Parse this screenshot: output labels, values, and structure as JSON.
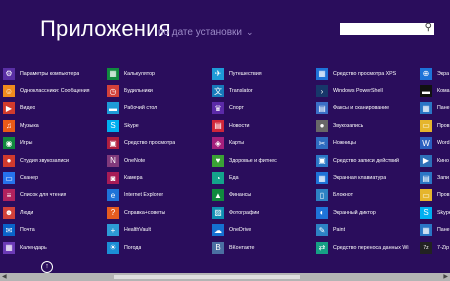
{
  "header": {
    "title": "Приложения",
    "sort_label": "по дате установки"
  },
  "columns": [
    [
      {
        "label": "Параметры компьютера",
        "icon": "gear-icon",
        "glyph": "⚙",
        "color": "#5a2fa5"
      },
      {
        "label": "Одноклассники: Сообщения",
        "icon": "ok-icon",
        "glyph": "☺",
        "color": "#f08b1d"
      },
      {
        "label": "Видео",
        "icon": "video-icon",
        "glyph": "▶",
        "color": "#d23b2c"
      },
      {
        "label": "Музыка",
        "icon": "headphones-icon",
        "glyph": "♫",
        "color": "#e95a17"
      },
      {
        "label": "Игры",
        "icon": "gamepad-icon",
        "glyph": "◉",
        "color": "#10893e"
      },
      {
        "label": "Студия звукозаписи",
        "icon": "microphone-icon",
        "glyph": "●",
        "color": "#d13a2d"
      },
      {
        "label": "Сканер",
        "icon": "scanner-icon",
        "glyph": "▭",
        "color": "#2672ec"
      },
      {
        "label": "Список для чтения",
        "icon": "reading-list-icon",
        "glyph": "≡",
        "color": "#b1225e"
      },
      {
        "label": "Люди",
        "icon": "people-icon",
        "glyph": "☻",
        "color": "#d2413a"
      },
      {
        "label": "Почта",
        "icon": "mail-icon",
        "glyph": "✉",
        "color": "#0a63c9"
      },
      {
        "label": "Календарь",
        "icon": "calendar-icon",
        "glyph": "▦",
        "color": "#6b3ab6"
      }
    ],
    [
      {
        "label": "Калькулятор",
        "icon": "calculator-icon",
        "glyph": "▦",
        "color": "#10893e"
      },
      {
        "label": "Будильники",
        "icon": "alarm-icon",
        "glyph": "◷",
        "color": "#d2413a"
      },
      {
        "label": "Рабочий стол",
        "icon": "desktop-icon",
        "glyph": "▬",
        "color": "#1e9ad7"
      },
      {
        "label": "Skype",
        "icon": "skype-icon",
        "glyph": "S",
        "color": "#00aff0"
      },
      {
        "label": "Средство просмотра",
        "icon": "viewer-icon",
        "glyph": "▣",
        "color": "#b01e3e"
      },
      {
        "label": "OneNote",
        "icon": "onenote-icon",
        "glyph": "N",
        "color": "#80397b"
      },
      {
        "label": "Камера",
        "icon": "camera-icon",
        "glyph": "◙",
        "color": "#a81b56"
      },
      {
        "label": "Internet Explorer",
        "icon": "ie-icon",
        "glyph": "e",
        "color": "#1e73d8"
      },
      {
        "label": "Справка+советы",
        "icon": "help-icon",
        "glyph": "?",
        "color": "#e55c1f"
      },
      {
        "label": "HealthVault",
        "icon": "healthvault-icon",
        "glyph": "+",
        "color": "#2d9ad6"
      },
      {
        "label": "Погода",
        "icon": "weather-icon",
        "glyph": "☀",
        "color": "#1b8ed6"
      }
    ],
    [
      {
        "label": "Путешествия",
        "icon": "travel-icon",
        "glyph": "✈",
        "color": "#1e9ad7"
      },
      {
        "label": "Translator",
        "icon": "translator-icon",
        "glyph": "文",
        "color": "#1779ba"
      },
      {
        "label": "Спорт",
        "icon": "trophy-icon",
        "glyph": "♛",
        "color": "#5b2aa8"
      },
      {
        "label": "Новости",
        "icon": "news-icon",
        "glyph": "▤",
        "color": "#d0263a"
      },
      {
        "label": "Карты",
        "icon": "maps-icon",
        "glyph": "◈",
        "color": "#a41f7c"
      },
      {
        "label": "Здоровье и фитнес",
        "icon": "health-icon",
        "glyph": "♥",
        "color": "#3aa135"
      },
      {
        "label": "Еда",
        "icon": "food-icon",
        "glyph": "◔",
        "color": "#14a38b"
      },
      {
        "label": "Финансы",
        "icon": "finance-icon",
        "glyph": "▲",
        "color": "#10893e"
      },
      {
        "label": "Фотографии",
        "icon": "photos-icon",
        "glyph": "▨",
        "color": "#0f8fb2"
      },
      {
        "label": "OneDrive",
        "icon": "cloud-icon",
        "glyph": "☁",
        "color": "#1570d1"
      },
      {
        "label": "ВКонтакте",
        "icon": "vk-icon",
        "glyph": "B",
        "color": "#4b6fa2"
      }
    ],
    [
      {
        "label": "Средство просмотра XPS",
        "icon": "xps-icon",
        "glyph": "▦",
        "color": "#1e73d8"
      },
      {
        "label": "Windows PowerShell",
        "icon": "powershell-icon",
        "glyph": "›",
        "color": "#17376a"
      },
      {
        "label": "Факсы и сканирование",
        "icon": "fax-icon",
        "glyph": "▤",
        "color": "#3b6fc7"
      },
      {
        "label": "Звукозапись",
        "icon": "sound-recorder-icon",
        "glyph": "●",
        "color": "#686868"
      },
      {
        "label": "Ножницы",
        "icon": "snipping-icon",
        "glyph": "✂",
        "color": "#2e6cc0"
      },
      {
        "label": "Средство записи действий",
        "icon": "steps-recorder-icon",
        "glyph": "▣",
        "color": "#2a76c5"
      },
      {
        "label": "Экранная клавиатура",
        "icon": "keyboard-icon",
        "glyph": "▦",
        "color": "#1e73d8"
      },
      {
        "label": "Блокнот",
        "icon": "notepad-icon",
        "glyph": "▯",
        "color": "#2d82c4"
      },
      {
        "label": "Экранный диктор",
        "icon": "narrator-icon",
        "glyph": "◐",
        "color": "#1e73d8"
      },
      {
        "label": "Paint",
        "icon": "paint-icon",
        "glyph": "✎",
        "color": "#2d82c4"
      },
      {
        "label": "Средство переноса данных Wi",
        "icon": "transfer-icon",
        "glyph": "⇄",
        "color": "#16a085"
      }
    ],
    [
      {
        "label": "Экра",
        "icon": "magnifier-icon",
        "glyph": "⊕",
        "color": "#1e73d8"
      },
      {
        "label": "Кома",
        "icon": "cmd-icon",
        "glyph": "▬",
        "color": "#111111"
      },
      {
        "label": "Пане",
        "icon": "control-panel-icon",
        "glyph": "▦",
        "color": "#2a76c5"
      },
      {
        "label": "Пров",
        "icon": "explorer-icon",
        "glyph": "▭",
        "color": "#e5b52c"
      },
      {
        "label": "Word",
        "icon": "wordpad-icon",
        "glyph": "W",
        "color": "#2a5fbf"
      },
      {
        "label": "Кино",
        "icon": "moviemaker-icon",
        "glyph": "▶",
        "color": "#2d6fb8"
      },
      {
        "label": "Запи",
        "icon": "stickynotes-icon",
        "glyph": "▤",
        "color": "#2a76c5"
      },
      {
        "label": "Пров",
        "icon": "explorer2-icon",
        "glyph": "▭",
        "color": "#e5b52c"
      },
      {
        "label": "Skype",
        "icon": "skype2-icon",
        "glyph": "S",
        "color": "#00aff0"
      },
      {
        "label": "Пане",
        "icon": "panel2-icon",
        "glyph": "▦",
        "color": "#2a76c5"
      },
      {
        "label": "7-Zip",
        "icon": "7zip-icon",
        "glyph": "7z",
        "color": "#222222"
      }
    ]
  ]
}
